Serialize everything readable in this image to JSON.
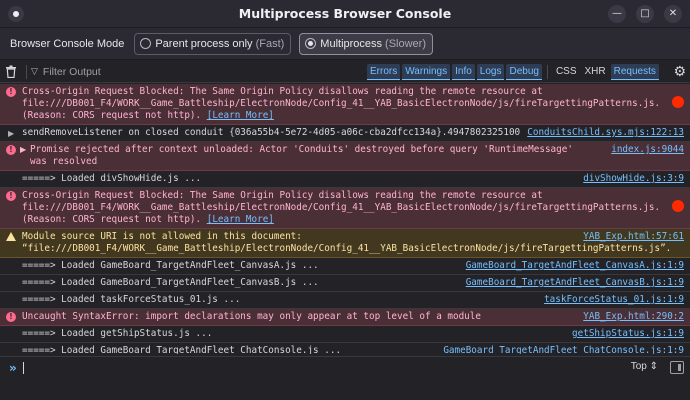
{
  "window": {
    "title": "Multiprocess Browser Console",
    "minimize_glyph": "—",
    "maximize_glyph": "□",
    "close_glyph": "✕"
  },
  "mode": {
    "label": "Browser Console Mode",
    "options": [
      {
        "label": "Parent process only",
        "hint": "(Fast)",
        "selected": false
      },
      {
        "label": "Multiprocess",
        "hint": "(Slower)",
        "selected": true
      }
    ]
  },
  "toolbar": {
    "filter_placeholder": "Filter Output",
    "levels": [
      {
        "label": "Errors",
        "active": true
      },
      {
        "label": "Warnings",
        "active": true
      },
      {
        "label": "Info",
        "active": true
      },
      {
        "label": "Logs",
        "active": true
      },
      {
        "label": "Debug",
        "active": true
      }
    ],
    "types": [
      {
        "label": "CSS",
        "active": false
      },
      {
        "label": "XHR",
        "active": false
      },
      {
        "label": "Requests",
        "active": true
      }
    ]
  },
  "messages": [
    {
      "level": "error",
      "text": "Cross-Origin Request Blocked: The Same Origin Policy disallows reading the remote resource at file:///DB001_F4/WORK__Game_Battleship/ElectronNode/Config_41__YAB_BasicElectronNode/js/fireTargettingPatterns.js. (Reason: CORS request not http).",
      "learn": "[Learn More]",
      "source": ""
    },
    {
      "level": "log",
      "expandable": true,
      "text": "sendRemoveListener on closed conduit {036a55b4-5e72-4d05-a06c-cba2dfcc134a}.4947802325100",
      "source": "ConduitsChild.sys.mjs:122:13"
    },
    {
      "level": "error",
      "expandable": true,
      "text": "Promise rejected after context unloaded: Actor 'Conduits' destroyed before query 'RuntimeMessage' was resolved",
      "source": "index.js:9044"
    },
    {
      "level": "log",
      "text": "=====> Loaded divShowHide.js ...",
      "source": "divShowHide.js:3:9"
    },
    {
      "level": "error",
      "text": "Cross-Origin Request Blocked: The Same Origin Policy disallows reading the remote resource at file:///DB001_F4/WORK__Game_Battleship/ElectronNode/Config_41__YAB_BasicElectronNode/js/fireTargettingPatterns.js. (Reason: CORS request not http).",
      "learn": "[Learn More]",
      "source": ""
    },
    {
      "level": "warn",
      "text": "Module source URI is not allowed in this document: “file:///DB001_F4/WORK__Game_Battleship/ElectronNode/Config_41__YAB_BasicElectronNode/js/fireTargettingPatterns.js”.",
      "source": "YAB_Exp.html:57:61"
    },
    {
      "level": "log",
      "text": "=====> Loaded GameBoard_TargetAndFleet_CanvasA.js ...",
      "source": "GameBoard_TargetAndFleet_CanvasA.js:1:9"
    },
    {
      "level": "log",
      "text": "=====> Loaded GameBoard_TargetAndFleet_CanvasB.js ...",
      "source": "GameBoard_TargetAndFleet_CanvasB.js:1:9"
    },
    {
      "level": "log",
      "text": "=====> Loaded taskForceStatus_01.js ...",
      "source": "taskForceStatus_01.js:1:9"
    },
    {
      "level": "error",
      "text": "Uncaught SyntaxError: import declarations may only appear at top level of a module",
      "source": "YAB_Exp.html:290:2"
    },
    {
      "level": "log",
      "text": "=====> Loaded getShipStatus.js ...",
      "source": "getShipStatus.js:1:9"
    },
    {
      "level": "log",
      "text": "=====> Loaded GameBoard_TargetAndFleet_ChatConsole.js ...",
      "source": "GameBoard_TargetAndFleet_ChatConsole.js:1:9"
    }
  ],
  "input": {
    "prompt": "»",
    "top_selector": "Top ⇕"
  }
}
